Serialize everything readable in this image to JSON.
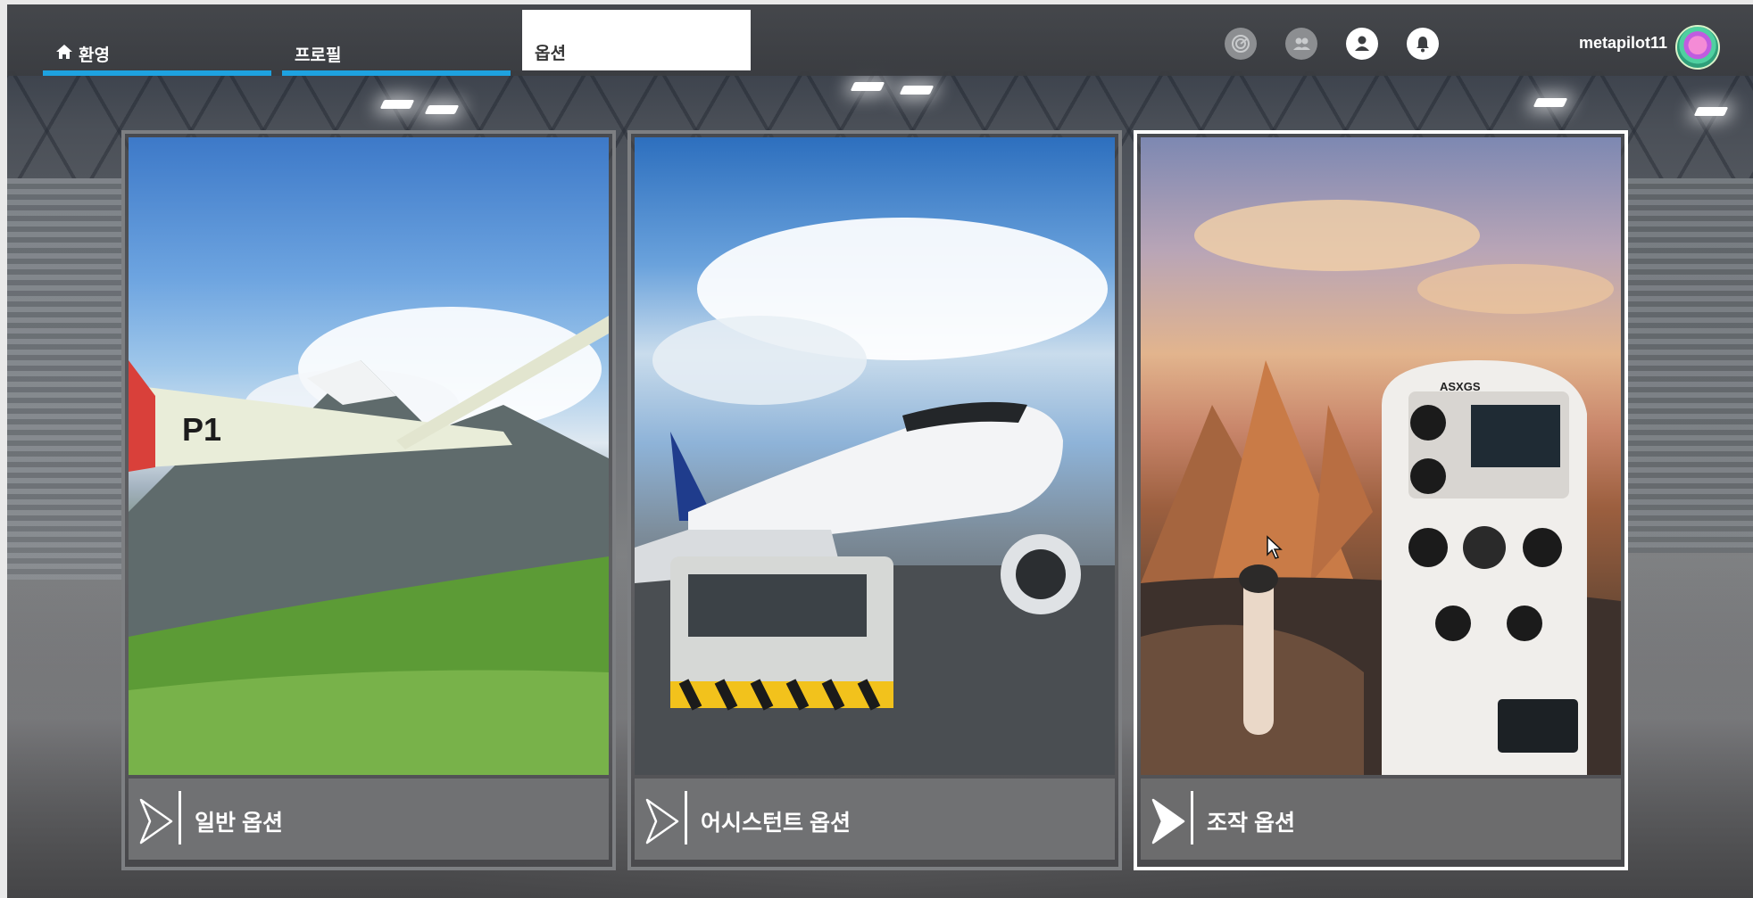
{
  "tabs": [
    {
      "label": "환영",
      "active": false
    },
    {
      "label": "프로필",
      "active": false
    },
    {
      "label": "옵션",
      "active": true
    }
  ],
  "header_icons": [
    {
      "icon": "radar-icon",
      "state": "disabled"
    },
    {
      "icon": "friends-icon",
      "state": "disabled"
    },
    {
      "icon": "profile-icon",
      "state": "enabled"
    },
    {
      "icon": "notification-bell-icon",
      "state": "enabled"
    }
  ],
  "user": {
    "name": "metapilot11"
  },
  "cards": [
    {
      "label": "일반 옵션",
      "image": "glider-over-mountains",
      "selected": false
    },
    {
      "label": "어시스턴트 옵션",
      "image": "airbus-with-tug",
      "selected": false
    },
    {
      "label": "조작 옵션",
      "image": "cockpit-with-pyramids",
      "selected": true
    }
  ],
  "colors": {
    "accent": "#1ea2e0",
    "topbar": "#44464a",
    "card_footer": "#707173",
    "selected_border": "#ffffff"
  }
}
